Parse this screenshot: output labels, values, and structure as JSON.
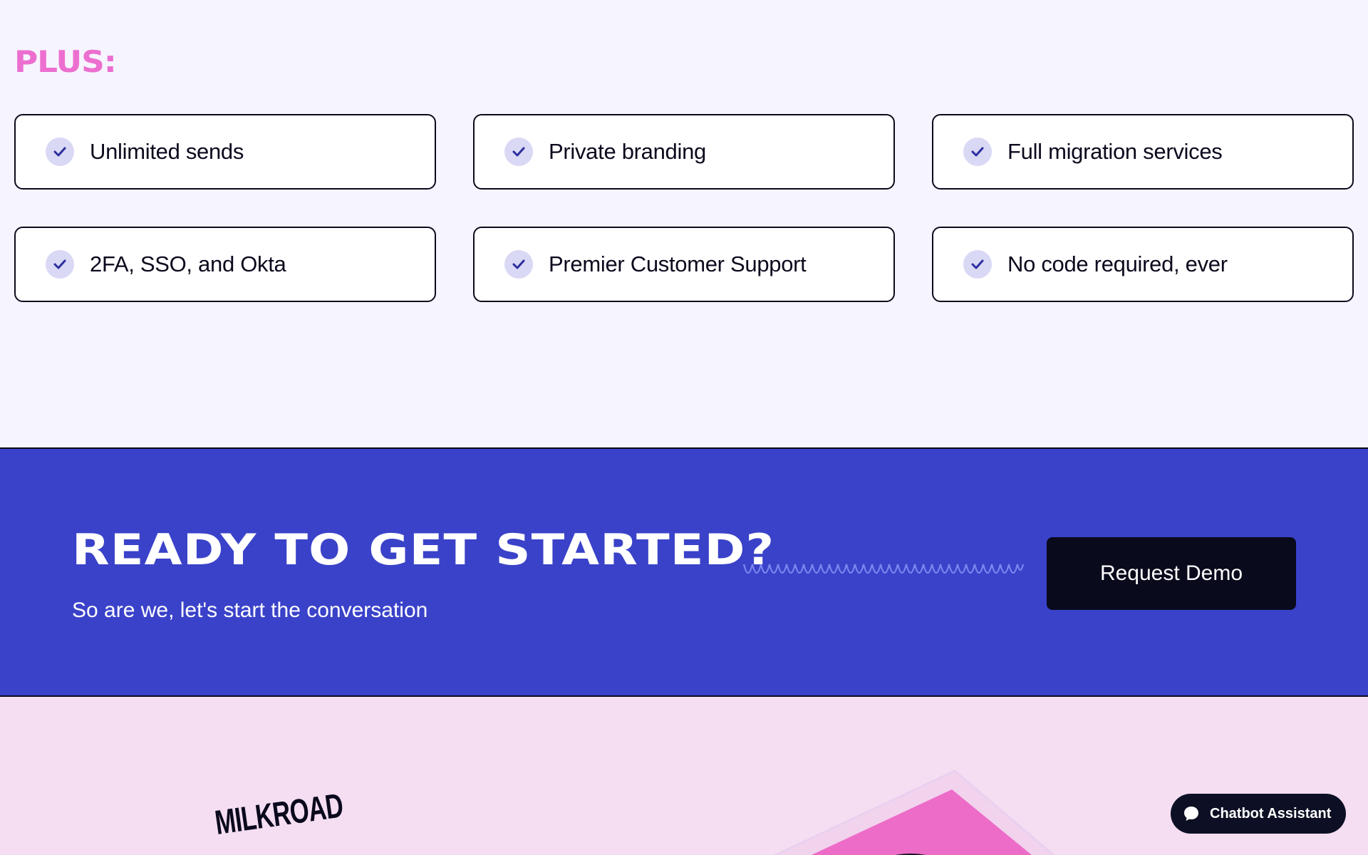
{
  "plus": {
    "heading": "PLUS:",
    "features": [
      {
        "label": "Unlimited sends"
      },
      {
        "label": "Private branding"
      },
      {
        "label": "Full migration services"
      },
      {
        "label": "2FA, SSO, and Okta"
      },
      {
        "label": "Premier Customer Support"
      },
      {
        "label": "No code required, ever"
      }
    ]
  },
  "cta": {
    "title": "READY TO GET STARTED?",
    "subtitle": "So are we, let's start the conversation",
    "button_label": "Request Demo"
  },
  "lower": {
    "logo_text": "MILKROAD"
  },
  "chatbot": {
    "label": "Chatbot Assistant"
  },
  "colors": {
    "page_bg": "#f6f4fe",
    "accent_pink": "#ec6fd0",
    "cta_blue": "#3a42c9",
    "dark": "#0b0a1d",
    "check_bg": "#d9d8f5",
    "lower_bg": "#f5def2"
  },
  "icons": [
    "check-icon",
    "wave-divider",
    "chat-bubble-icon"
  ]
}
